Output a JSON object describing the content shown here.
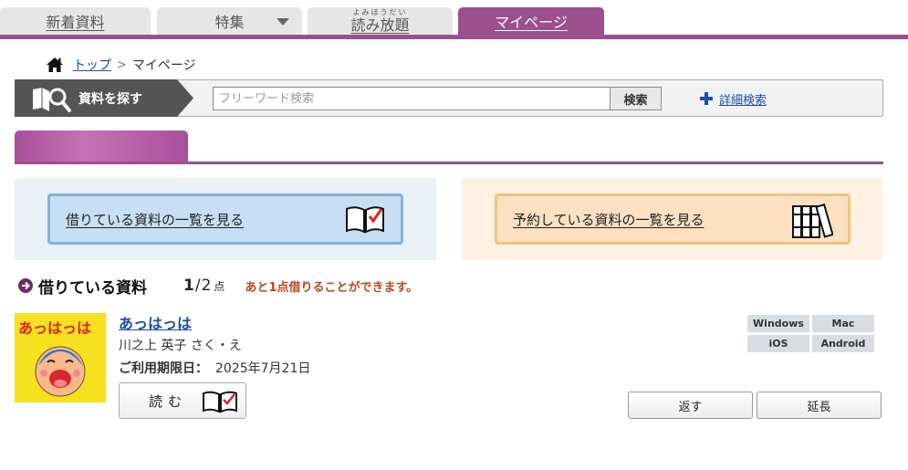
{
  "tabs": [
    {
      "label": "新着資料",
      "ruby": ""
    },
    {
      "label": "特集",
      "ruby": ""
    },
    {
      "label": "読み放題",
      "ruby": "よみほうだい"
    },
    {
      "label": "マイページ",
      "ruby": ""
    }
  ],
  "breadcrumb": {
    "home_label": "トップ",
    "separator": ">",
    "current": "マイページ"
  },
  "search": {
    "label": "資料を探す",
    "placeholder": "フリーワード検索",
    "button_label": "検索",
    "advanced_label": "詳細検索"
  },
  "panels": {
    "borrowed_label": "借りている資料の一覧を見る",
    "reserved_label": "予約している資料の一覧を見る"
  },
  "borrowing": {
    "title": "借りている資料",
    "count_current": "1",
    "count_separator": "/",
    "count_max": "2",
    "count_unit": "点",
    "remaining_message": "あと1点借りることができます。"
  },
  "book": {
    "title": "あっはっは",
    "cover_title": "あっはっは",
    "author": "川之上 英子 さく・え",
    "due_label": "ご利用期限日：",
    "due_date": "2025年7月21日",
    "read_label": "読む"
  },
  "devices": [
    "Windows",
    "Mac",
    "iOS",
    "Android"
  ],
  "actions": {
    "return_label": "返す",
    "extend_label": "延長"
  },
  "colors": {
    "accent": "#9b4f8f",
    "link": "#1a4fa8",
    "message": "#b8471f"
  }
}
